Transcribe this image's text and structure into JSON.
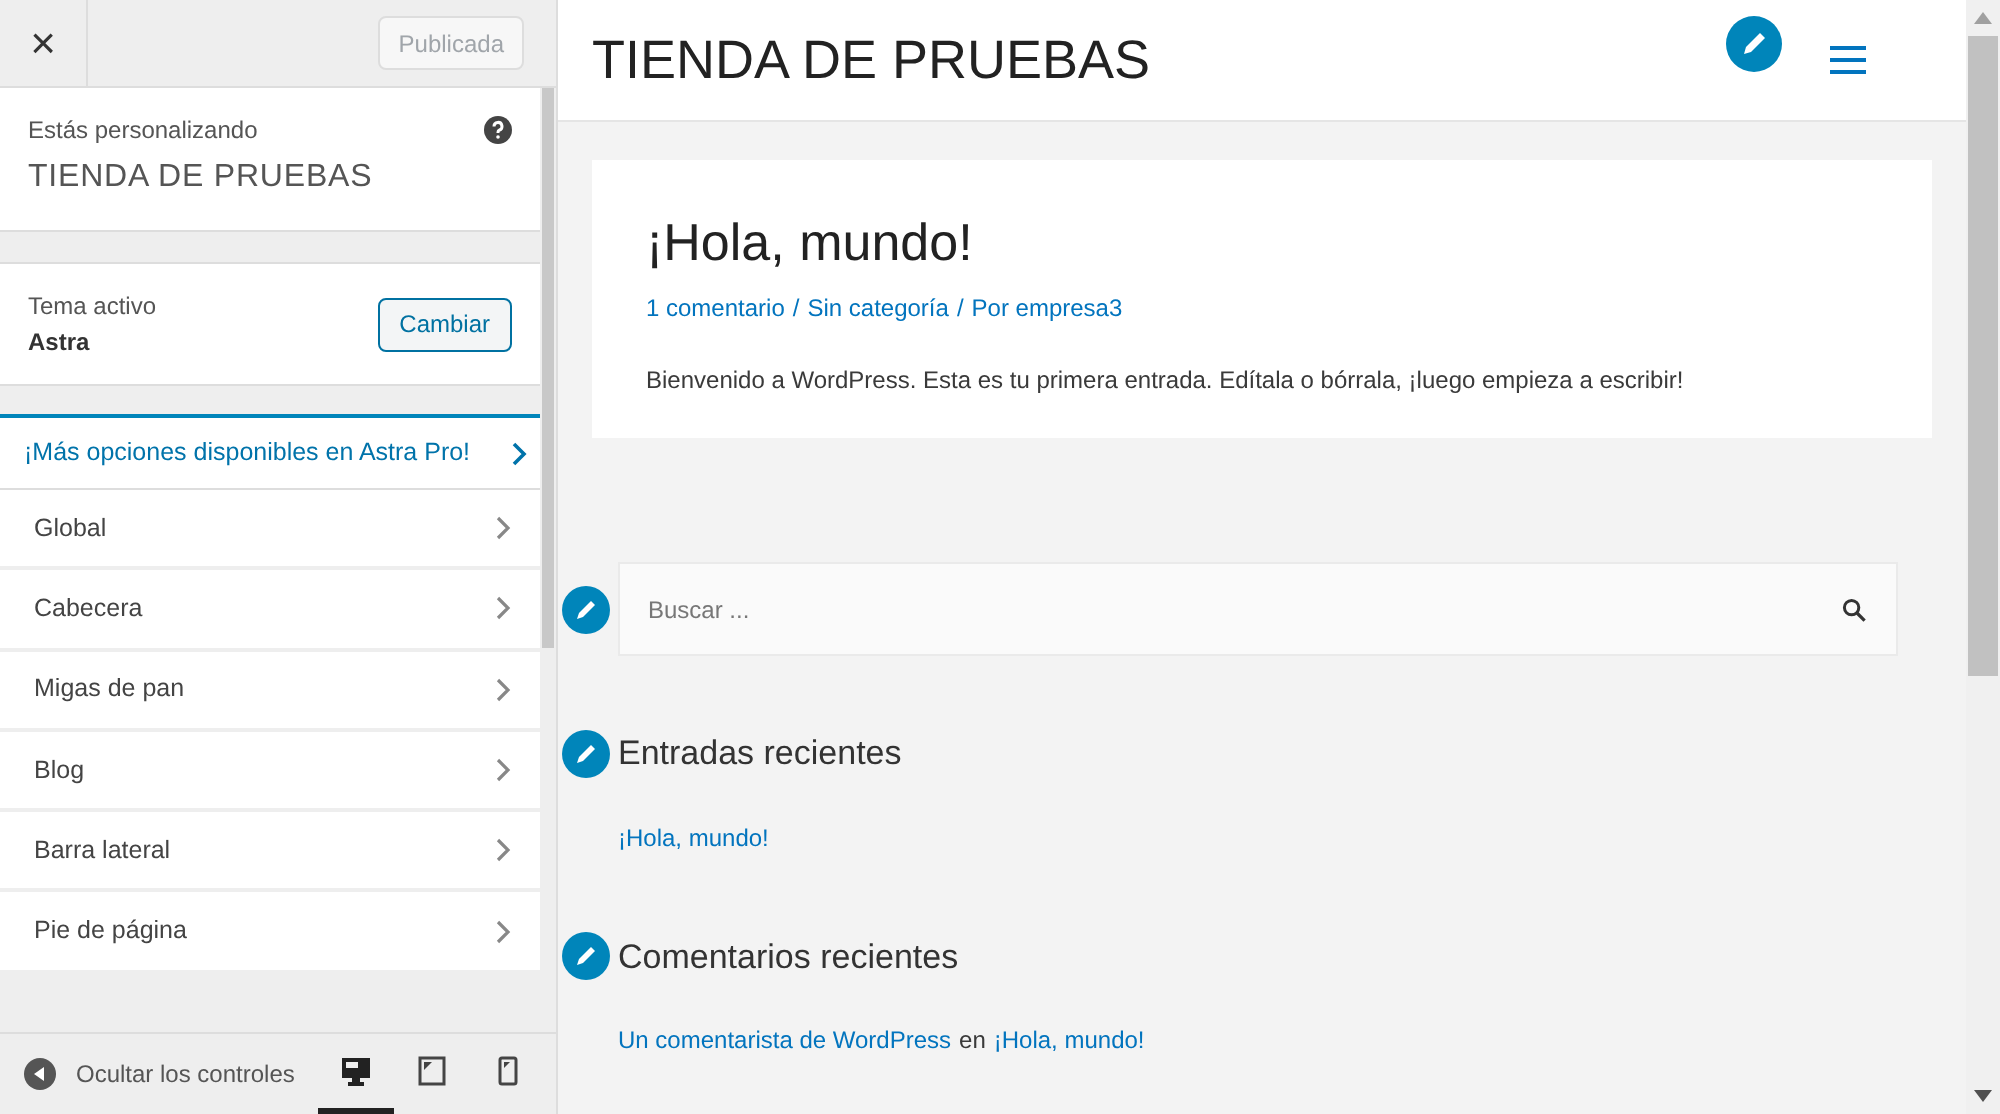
{
  "sidebar": {
    "close_label": "×",
    "publish_button": {
      "label": "Publicada",
      "disabled": true
    },
    "customizing": {
      "label": "Estás personalizando",
      "site_title": "TIENDA DE PRUEBAS"
    },
    "theme": {
      "label": "Tema activo",
      "name": "Astra",
      "button": "Cambiar"
    },
    "promo": "¡Más opciones disponibles en Astra Pro!",
    "sections": [
      {
        "label": "Global"
      },
      {
        "label": "Cabecera"
      },
      {
        "label": "Migas de pan"
      },
      {
        "label": "Blog"
      },
      {
        "label": "Barra lateral"
      },
      {
        "label": "Pie de página"
      }
    ],
    "footer": {
      "hide_label": "Ocultar los controles",
      "devices": [
        {
          "kind": "desktop",
          "selected": true
        },
        {
          "kind": "tablet",
          "selected": false
        },
        {
          "kind": "mobile",
          "selected": false
        }
      ]
    }
  },
  "preview": {
    "site_title": "TIENDA DE PRUEBAS",
    "post": {
      "title": "¡Hola, mundo!",
      "meta": [
        {
          "text": "1 comentario"
        },
        {
          "text": "Sin categoría"
        },
        {
          "text": "Por empresa3"
        }
      ],
      "meta_separator": "/",
      "excerpt": "Bienvenido a WordPress. Esta es tu primera entrada. Edítala o bórrala, ¡luego empieza a escribir!"
    },
    "search": {
      "placeholder": "Buscar ..."
    },
    "recent_posts": {
      "title": "Entradas recientes",
      "items": [
        "¡Hola, mundo!"
      ]
    },
    "recent_comments": {
      "title": "Comentarios recientes",
      "items": [
        {
          "author": "Un comentarista de WordPress",
          "connector": "en",
          "post": "¡Hola, mundo!"
        }
      ]
    }
  }
}
